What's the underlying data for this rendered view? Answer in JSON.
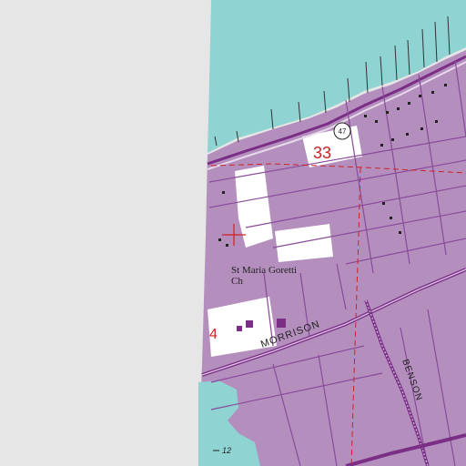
{
  "map": {
    "labels": {
      "section_33": "33",
      "section_4": "4",
      "route_shield": "47",
      "church_line1": "St Maria Goretti",
      "church_line2": "Ch",
      "road_morrison": "MORRISON",
      "road_benson": "BENSON",
      "elevation_mark": "12"
    },
    "colors": {
      "water": "#8fd3d3",
      "urban_tint": "#b48fbe",
      "unmapped": "#e6e6e6",
      "open_land": "#ffffff",
      "street": "#8a4a9a",
      "major_road": "#7a2e86",
      "section_red": "#cc2222",
      "text": "#222222"
    }
  }
}
